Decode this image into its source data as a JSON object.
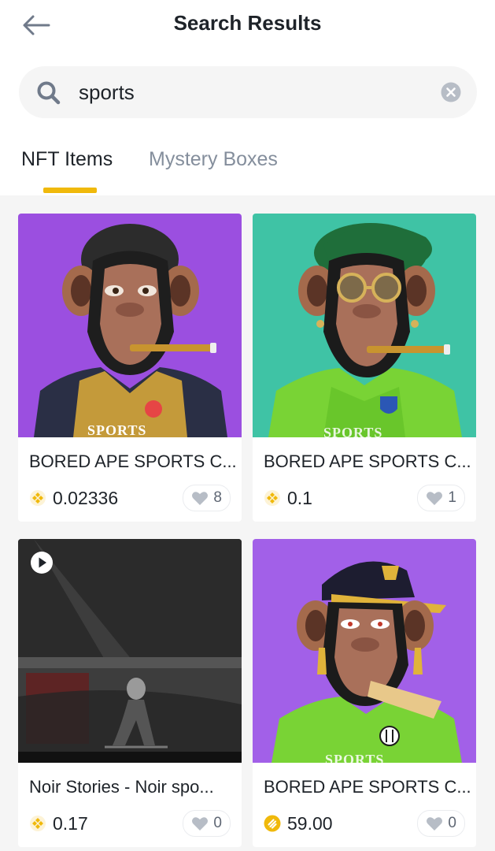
{
  "header": {
    "title": "Search Results"
  },
  "search": {
    "value": "sports"
  },
  "tabs": [
    {
      "label": "NFT Items"
    },
    {
      "label": "Mystery Boxes"
    }
  ],
  "items": [
    {
      "name": "BORED APE SPORTS C...",
      "price": "0.02336",
      "likes": "8",
      "image_text": "SPORTS",
      "bg": "#9b4fe0"
    },
    {
      "name": "BORED APE SPORTS C...",
      "price": "0.1",
      "likes": "1",
      "image_text": "SPORTS",
      "bg": "#3fc3a5"
    },
    {
      "name": "Noir Stories - Noir spo...",
      "price": "0.17",
      "likes": "0",
      "bg": "#1a1a1a"
    },
    {
      "name": "BORED APE SPORTS C...",
      "price": "59.00",
      "likes": "0",
      "image_text": "SPORTS",
      "bg": "#a260e8"
    }
  ],
  "colors": {
    "accent": "#f0b90b",
    "coin": "#f0b90b"
  }
}
